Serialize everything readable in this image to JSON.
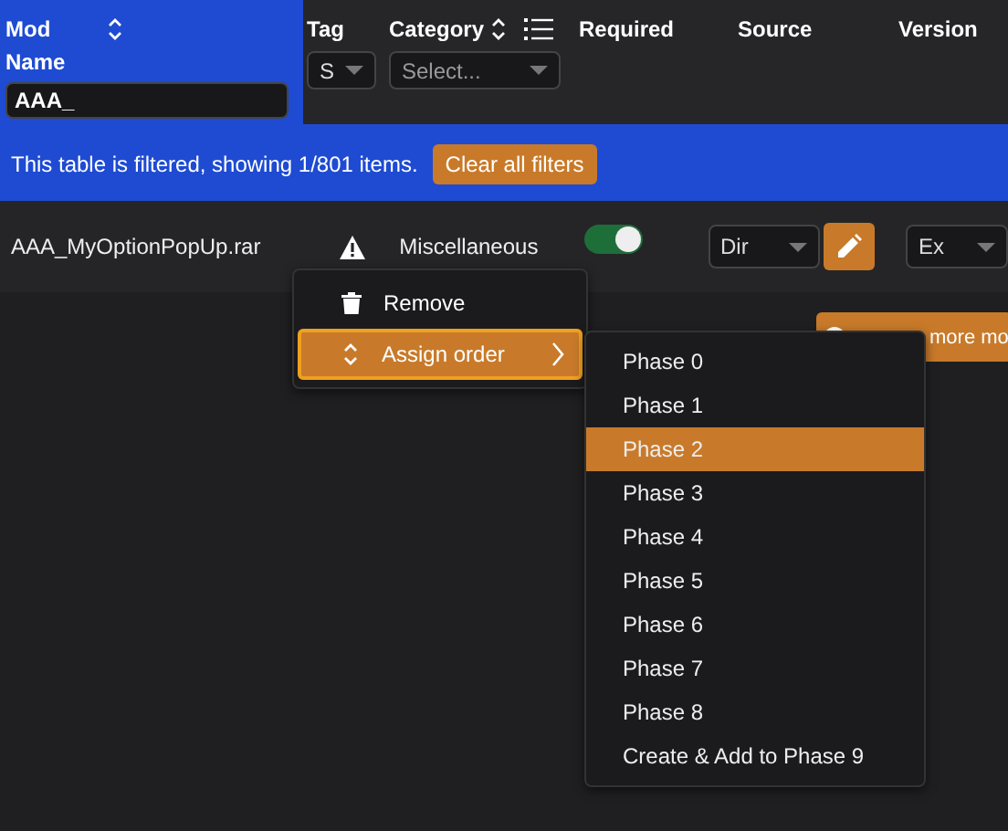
{
  "header": {
    "columns": [
      {
        "label": "Mod Name",
        "kind": "name",
        "sortable": true,
        "filter": {
          "kind": "text",
          "value": "AAA_"
        }
      },
      {
        "label": "Tag",
        "kind": "tag",
        "filter": {
          "kind": "select",
          "value": "S"
        }
      },
      {
        "label": "Category",
        "kind": "category",
        "sortable": true,
        "filter": {
          "kind": "select",
          "placeholder": "Select..."
        }
      },
      {
        "label": "Required",
        "kind": "required"
      },
      {
        "label": "Source",
        "kind": "source"
      },
      {
        "label": "Version",
        "kind": "version"
      }
    ]
  },
  "filter_banner": {
    "message": "This table is filtered, showing 1/801 items.",
    "button": "Clear all filters"
  },
  "rows": [
    {
      "name": "AAA_MyOptionPopUp.rar",
      "warning": true,
      "category": "Miscellaneous",
      "required": true,
      "source": "Dir",
      "version": "Ex"
    }
  ],
  "add_button": {
    "label": "more mo"
  },
  "context_menu": {
    "items": [
      {
        "label": "Remove",
        "kind": "remove",
        "selected": false
      },
      {
        "label": "Assign order",
        "kind": "submenu",
        "selected": true
      }
    ]
  },
  "submenu": {
    "items": [
      {
        "label": "Phase 0",
        "selected": false
      },
      {
        "label": "Phase 1",
        "selected": false
      },
      {
        "label": "Phase 2",
        "selected": true
      },
      {
        "label": "Phase 3",
        "selected": false
      },
      {
        "label": "Phase 4",
        "selected": false
      },
      {
        "label": "Phase 5",
        "selected": false
      },
      {
        "label": "Phase 6",
        "selected": false
      },
      {
        "label": "Phase 7",
        "selected": false
      },
      {
        "label": "Phase 8",
        "selected": false
      },
      {
        "label": "Create & Add to Phase 9",
        "selected": false
      }
    ]
  }
}
